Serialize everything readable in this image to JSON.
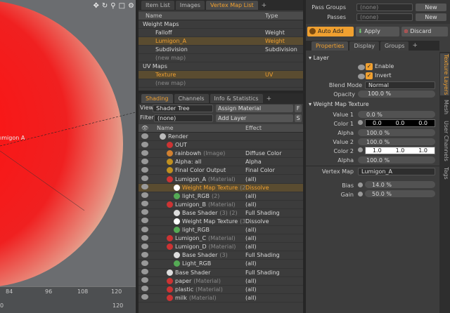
{
  "viewport": {
    "icons": [
      "move-icon",
      "rotate-icon",
      "zoom-icon",
      "maximize-icon",
      "gear-icon"
    ],
    "label": "ımigon A",
    "ruler_ticks": [
      "84",
      "96",
      "108",
      "120"
    ],
    "ruler_ticks2": [
      "0",
      "120"
    ]
  },
  "vmap": {
    "tabs": [
      "Item List",
      "Images",
      "Vertex Map List"
    ],
    "active_tab": 2,
    "columns": [
      "Name",
      "Type"
    ],
    "rows": [
      {
        "name": "Weight Maps",
        "type": "",
        "indent": 0,
        "style": "normal"
      },
      {
        "name": "Falloff",
        "type": "Weight",
        "indent": 1,
        "style": "normal"
      },
      {
        "name": "Lumigon_A",
        "type": "Weight",
        "indent": 1,
        "style": "sel"
      },
      {
        "name": "Subdivision",
        "type": "Subdivision",
        "indent": 1,
        "style": "normal"
      },
      {
        "name": "(new map)",
        "type": "",
        "indent": 1,
        "style": "dim"
      },
      {
        "name": "UV Maps",
        "type": "",
        "indent": 0,
        "style": "normal"
      },
      {
        "name": "Texture",
        "type": "UV",
        "indent": 1,
        "style": "sel"
      },
      {
        "name": "(new map)",
        "type": "",
        "indent": 1,
        "style": "dim"
      }
    ]
  },
  "shading": {
    "tabs": [
      "Shading",
      "Channels",
      "Info & Statistics"
    ],
    "active_tab": 0,
    "view_label": "View",
    "view_value": "Shader Tree",
    "assign_label": "Assign Material",
    "filter_label": "Filter",
    "filter_value": "(none)",
    "add_layer_label": "Add Layer",
    "f_label": "F",
    "s_label": "S",
    "columns": [
      "Name",
      "Effect"
    ],
    "rows": [
      {
        "name": "Render",
        "sub": "",
        "effect": "",
        "indent": 0,
        "ball": "#bbbbbb",
        "style": "normal"
      },
      {
        "name": "OUT",
        "sub": "",
        "effect": "",
        "indent": 1,
        "ball": "#cc3333",
        "style": "normal"
      },
      {
        "name": "rainbowh",
        "sub": "(Image)",
        "effect": "Diffuse Color",
        "indent": 1,
        "ball": "#d08030",
        "style": "normal"
      },
      {
        "name": "Alpha: all",
        "sub": "",
        "effect": "Alpha",
        "indent": 1,
        "ball": "#c09020",
        "style": "normal"
      },
      {
        "name": "Final Color Output",
        "sub": "",
        "effect": "Final Color",
        "indent": 1,
        "ball": "#c09020",
        "style": "normal"
      },
      {
        "name": "Lumigon_A",
        "sub": "(Material)",
        "effect": "(all)",
        "indent": 1,
        "ball": "#cc3333",
        "style": "normal"
      },
      {
        "name": "Weight Map Texture",
        "sub": "(2)",
        "effect": "Dissolve",
        "indent": 2,
        "ball": "#ffffff",
        "style": "sel"
      },
      {
        "name": "light_RGB",
        "sub": "(2)",
        "effect": "(all)",
        "indent": 2,
        "ball": "#55aa55",
        "style": "normal"
      },
      {
        "name": "Lumigon_B",
        "sub": "(Material)",
        "effect": "(all)",
        "indent": 1,
        "ball": "#cc3333",
        "style": "normal"
      },
      {
        "name": "Base Shader",
        "sub": "(3) (2)",
        "effect": "Full Shading",
        "indent": 2,
        "ball": "#dddddd",
        "style": "normal"
      },
      {
        "name": "Weight Map Texture",
        "sub": "(3)",
        "effect": "Dissolve",
        "indent": 2,
        "ball": "#ffffff",
        "style": "normal"
      },
      {
        "name": "light_RGB",
        "sub": "",
        "effect": "(all)",
        "indent": 2,
        "ball": "#55aa55",
        "style": "normal"
      },
      {
        "name": "Lumigon_C",
        "sub": "(Material)",
        "effect": "(all)",
        "indent": 1,
        "ball": "#cc3333",
        "style": "normal"
      },
      {
        "name": "Lumigon_D",
        "sub": "(Material)",
        "effect": "(all)",
        "indent": 1,
        "ball": "#cc3333",
        "style": "normal"
      },
      {
        "name": "Base Shader",
        "sub": "(3)",
        "effect": "Full Shading",
        "indent": 2,
        "ball": "#dddddd",
        "style": "normal"
      },
      {
        "name": "Light_RGB",
        "sub": "",
        "effect": "(all)",
        "indent": 2,
        "ball": "#55aa55",
        "style": "normal"
      },
      {
        "name": "Base Shader",
        "sub": "",
        "effect": "Full Shading",
        "indent": 1,
        "ball": "#dddddd",
        "style": "normal"
      },
      {
        "name": "paper",
        "sub": "(Material)",
        "effect": "(all)",
        "indent": 1,
        "ball": "#cc3333",
        "style": "normal"
      },
      {
        "name": "plastic",
        "sub": "(Material)",
        "effect": "(all)",
        "indent": 1,
        "ball": "#cc3333",
        "style": "normal"
      },
      {
        "name": "milk",
        "sub": "(Material)",
        "effect": "(all)",
        "indent": 1,
        "ball": "#cc3333",
        "style": "normal"
      }
    ]
  },
  "right": {
    "pass_groups_label": "Pass Groups",
    "pass_groups_value": "(none)",
    "passes_label": "Passes",
    "passes_value": "(none)",
    "new_label": "New",
    "auto_add": "Auto Add",
    "apply": "Apply",
    "discard": "Discard",
    "tabs": [
      "Properties",
      "Display",
      "Groups"
    ],
    "side_tabs": [
      "Texture Layers",
      "Mesh",
      "User Channels",
      "Tags"
    ],
    "section_layer": "Layer",
    "enable_label": "Enable",
    "invert_label": "Invert",
    "blend_mode_label": "Blend Mode",
    "blend_mode_value": "Normal",
    "opacity_label": "Opacity",
    "opacity_value": "100.0 %",
    "section_wmt": "Weight Map Texture",
    "value1_label": "Value 1",
    "value1": "0.0 %",
    "color1_label": "Color 1",
    "color1": [
      "0.0",
      "0.0",
      "0.0"
    ],
    "alpha1_label": "Alpha",
    "alpha1": "100.0 %",
    "value2_label": "Value 2",
    "value2": "100.0 %",
    "color2_label": "Color 2",
    "color2": [
      "1.0",
      "1.0",
      "1.0"
    ],
    "alpha2_label": "Alpha",
    "alpha2": "100.0 %",
    "vertex_map_label": "Vertex Map",
    "vertex_map_value": "Lumigon_A",
    "bias_label": "Bias",
    "bias_value": "14.0 %",
    "gain_label": "Gain",
    "gain_value": "50.0 %"
  }
}
